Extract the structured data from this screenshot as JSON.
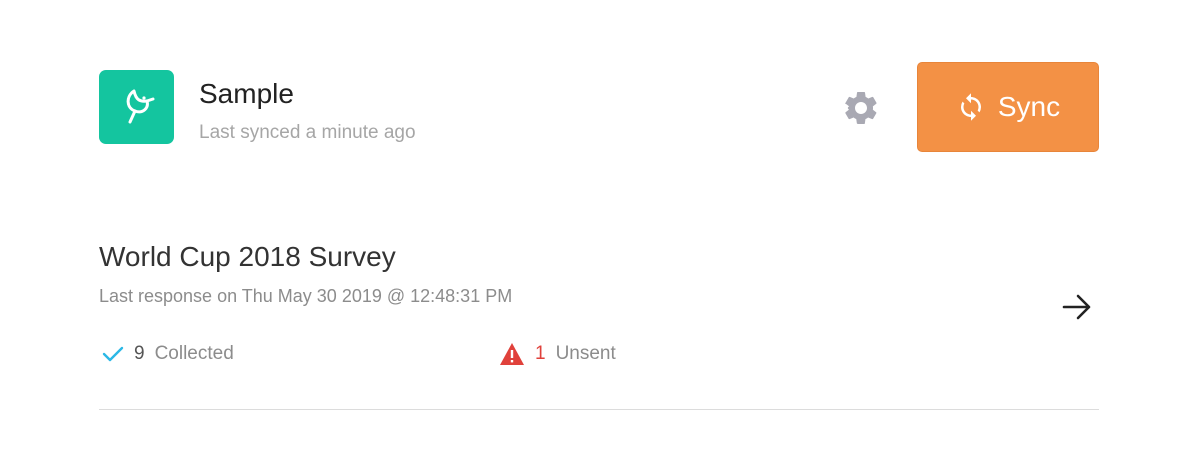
{
  "header": {
    "app_logo_icon": "bird-logo-icon",
    "app_name": "Sample",
    "sync_status": "Last synced a minute ago",
    "settings_icon": "gear-icon",
    "sync_button": {
      "icon": "sync-arrows-icon",
      "label": "Sync"
    }
  },
  "survey": {
    "title": "World Cup 2018 Survey",
    "last_response": "Last response on Thu May 30 2019 @ 12:48:31 PM",
    "open_icon": "arrow-right-icon",
    "collected": {
      "icon": "checkmark-icon",
      "count": "9",
      "label": "Collected"
    },
    "unsent": {
      "icon": "warning-triangle-icon",
      "count": "1",
      "label": "Unsent"
    }
  },
  "colors": {
    "brand_green": "#14c59f",
    "sync_orange": "#f39145",
    "check_blue": "#2bb8e6",
    "warning_red": "#e0413b",
    "gear_gray": "#a9a9b3"
  }
}
